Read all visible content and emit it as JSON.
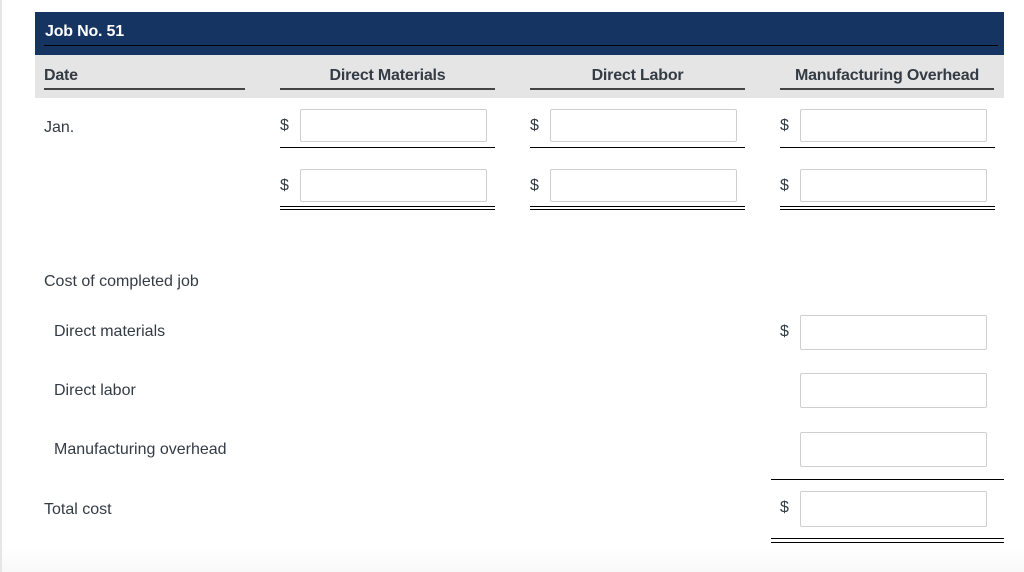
{
  "job": {
    "title": "Job No. 51"
  },
  "columns": {
    "date": "Date",
    "direct_materials": "Direct Materials",
    "direct_labor": "Direct Labor",
    "manufacturing_overhead": "Manufacturing Overhead"
  },
  "currency_symbol": "$",
  "rows": {
    "jan_label": "Jan.",
    "jan": {
      "direct_materials": "",
      "direct_labor": "",
      "manufacturing_overhead": ""
    },
    "totals": {
      "direct_materials": "",
      "direct_labor": "",
      "manufacturing_overhead": ""
    }
  },
  "summary": {
    "heading": "Cost of completed job",
    "direct_materials_label": "Direct materials",
    "direct_materials_value": "",
    "direct_labor_label": "Direct labor",
    "direct_labor_value": "",
    "manufacturing_overhead_label": "Manufacturing overhead",
    "manufacturing_overhead_value": "",
    "total_cost_label": "Total cost",
    "total_cost_value": ""
  }
}
